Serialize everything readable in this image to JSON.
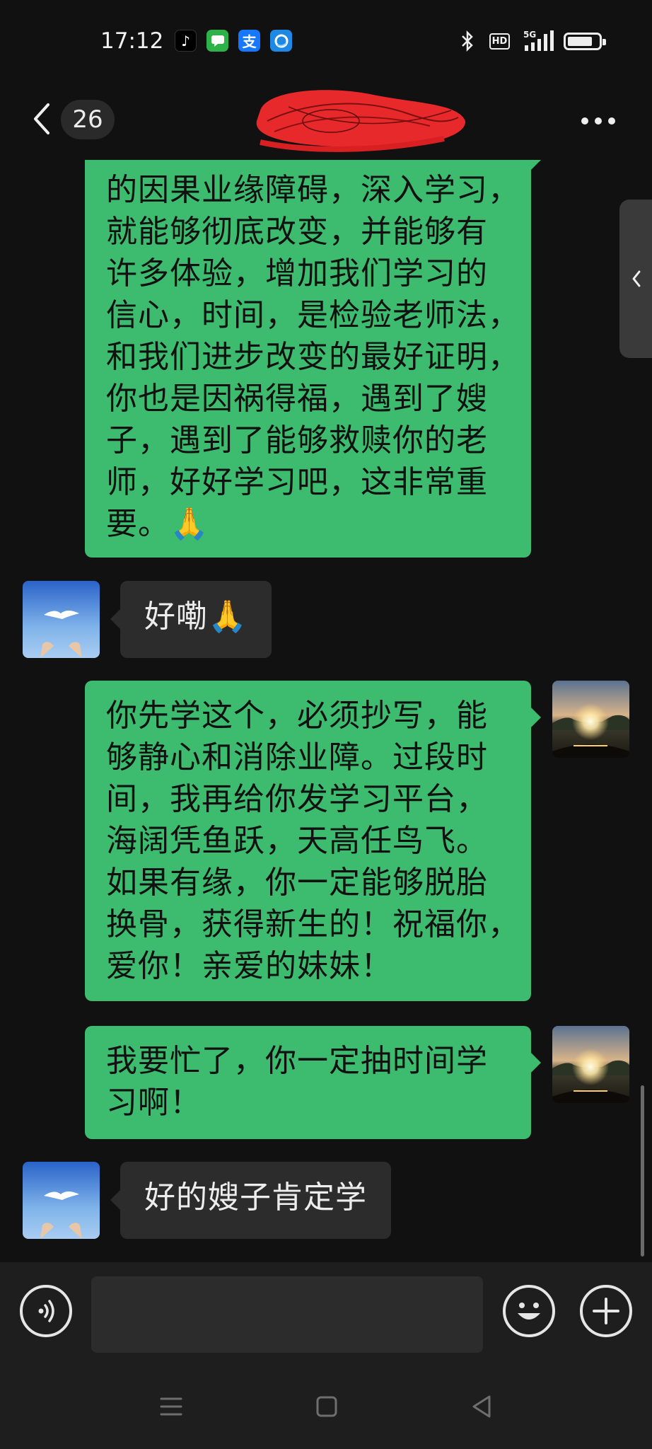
{
  "status_bar": {
    "time": "17:12",
    "network_label": "5G",
    "hd_label": "HD",
    "notification_icons": [
      "tiktok-icon",
      "messages-icon",
      "alipay-icon",
      "browser-icon"
    ],
    "alipay_glyph": "支"
  },
  "header": {
    "unread_count": "26",
    "contact_name_redacted": true
  },
  "messages": [
    {
      "direction": "out",
      "lines": [
        "的因果业缘障碍，深入学习，",
        "就能够彻底改变，并能够有",
        "许多体验，增加我们学习的",
        "信心，时间，是检验老师法，",
        "和我们进步改变的最好证明，",
        "你也是因祸得福，遇到了嫂",
        "子，遇到了能够救赎你的老",
        "师，好好学习吧，这非常重",
        "要。🙏"
      ]
    },
    {
      "direction": "in",
      "text": "好嘞🙏"
    },
    {
      "direction": "out",
      "lines": [
        "你先学这个，必须抄写，能",
        "够静心和消除业障。过段时",
        "间，我再给你发学习平台，",
        "海阔凭鱼跃，天高任鸟飞。",
        "如果有缘，你一定能够脱胎",
        "换骨，获得新生的！祝福你，",
        "爱你！亲爱的妹妹！"
      ]
    },
    {
      "direction": "out",
      "lines": [
        "我要忙了，你一定抽时间学",
        "习啊！"
      ]
    },
    {
      "direction": "in",
      "text": "好的嫂子肯定学"
    }
  ],
  "input": {
    "value": "",
    "placeholder": ""
  },
  "colors": {
    "background": "#111111",
    "outgoing_bubble": "#3dbb6f",
    "incoming_bubble": "#2c2c2c",
    "input_bar": "#1e1e1e",
    "redaction": "#e8292b"
  }
}
